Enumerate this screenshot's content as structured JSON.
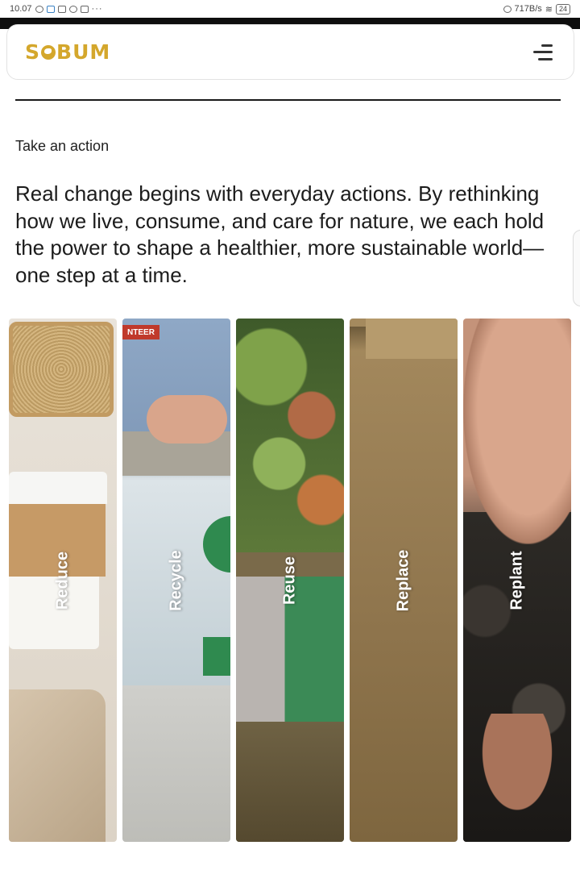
{
  "status_bar": {
    "time": "10.07",
    "net_speed": "717B/s",
    "battery": "24"
  },
  "header": {
    "logo_text_left": "S",
    "logo_text_right": "BUM"
  },
  "content": {
    "eyebrow": "Take an action",
    "lead": "Real change begins with everyday actions. By rethinking how we live, consume, and care for nature, we each hold the power to shape a healthier, more sustainable world—one step at a time."
  },
  "actions": [
    {
      "label": "Reduce"
    },
    {
      "label": "Recycle",
      "image_tag_text": "NTEER"
    },
    {
      "label": "Reuse"
    },
    {
      "label": "Replace"
    },
    {
      "label": "Replant"
    }
  ],
  "colors": {
    "brand": "#d4a72c",
    "text": "#1c1c1c"
  }
}
